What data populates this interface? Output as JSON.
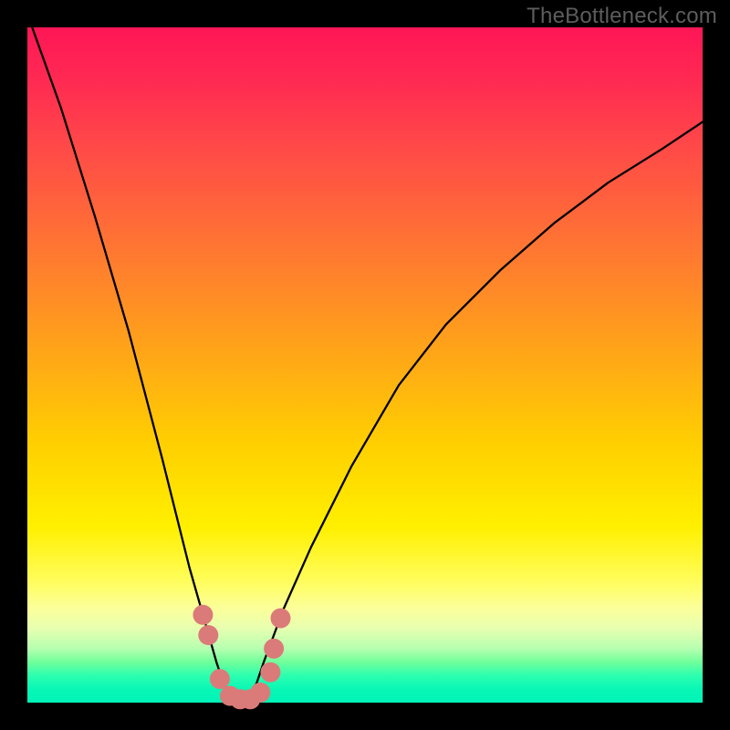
{
  "watermark": "TheBottleneck.com",
  "colors": {
    "frame": "#000000",
    "marker": "#db7b79",
    "curve": "#000000"
  },
  "chart_data": {
    "type": "line",
    "title": "",
    "xlabel": "",
    "ylabel": "",
    "xlim": [
      0,
      100
    ],
    "ylim": [
      0,
      100
    ],
    "grid": false,
    "legend": false,
    "series": [
      {
        "name": "bottleneck-curve",
        "x": [
          0,
          5,
          10,
          15,
          20,
          22,
          24,
          26,
          28,
          29,
          30,
          31,
          32,
          33,
          34,
          35,
          38,
          42,
          48,
          55,
          62,
          70,
          78,
          86,
          94,
          100
        ],
        "y": [
          102,
          88,
          72,
          55,
          36,
          28,
          20,
          13,
          6,
          3,
          1,
          0,
          0,
          1,
          3,
          6,
          14,
          23,
          35,
          47,
          56,
          64,
          71,
          77,
          82,
          86
        ]
      }
    ],
    "markers": [
      {
        "name": "left-upper",
        "x": 26.0,
        "y": 13.0
      },
      {
        "name": "left-mid",
        "x": 26.8,
        "y": 10.0
      },
      {
        "name": "elbow-left",
        "x": 28.5,
        "y": 3.5
      },
      {
        "name": "trough-left",
        "x": 30.0,
        "y": 1.0
      },
      {
        "name": "trough-mid",
        "x": 31.5,
        "y": 0.5
      },
      {
        "name": "trough-ctr",
        "x": 33.0,
        "y": 0.5
      },
      {
        "name": "trough-rt",
        "x": 34.5,
        "y": 1.5
      },
      {
        "name": "elbow-right",
        "x": 36.0,
        "y": 4.5
      },
      {
        "name": "right-mid",
        "x": 36.5,
        "y": 8.0
      },
      {
        "name": "right-upper",
        "x": 37.5,
        "y": 12.5
      }
    ],
    "background_gradient": {
      "top": "#ff1656",
      "mid_upper": "#ff7a30",
      "mid": "#fff000",
      "lower": "#08f7b5"
    }
  }
}
